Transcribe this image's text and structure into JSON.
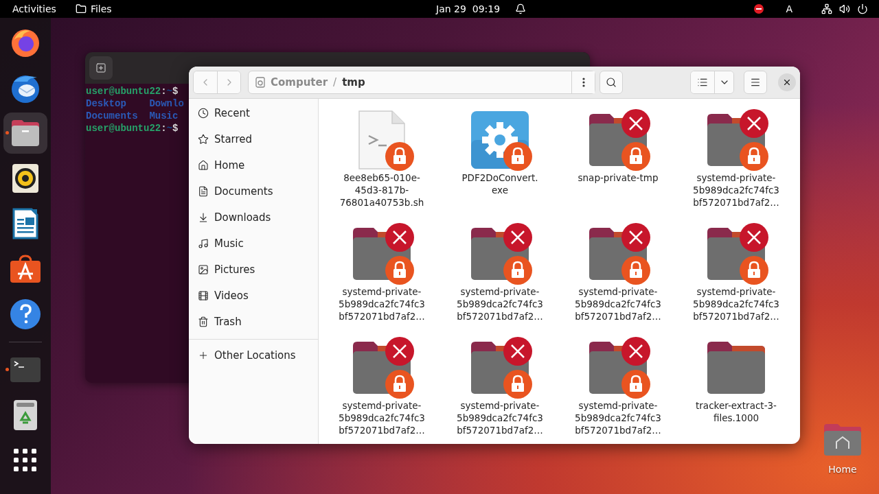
{
  "top_bar": {
    "activities": "Activities",
    "app_menu": "Files",
    "clock": "Jan 29  09:19",
    "keyboard": "A"
  },
  "dock": {
    "apps": [
      {
        "running": false,
        "active": false
      },
      {
        "running": false,
        "active": false
      },
      {
        "running": true,
        "active": true
      },
      {
        "running": false,
        "active": false
      },
      {
        "running": false,
        "active": false
      },
      {
        "running": false,
        "active": false
      },
      {
        "running": false,
        "active": false
      },
      {
        "running": true,
        "active": false
      },
      {
        "running": false,
        "active": false
      },
      {
        "running": false,
        "active": false
      }
    ]
  },
  "terminal": {
    "lines": [
      {
        "kind": "prompt",
        "user": "user@ubuntu22",
        "colon": ":",
        "path": "~",
        "sign": "$"
      },
      {
        "kind": "listing",
        "items": [
          "Desktop",
          "Downlo"
        ]
      },
      {
        "kind": "listing",
        "items": [
          "Documents",
          "Music"
        ]
      },
      {
        "kind": "prompt",
        "user": "user@ubuntu22",
        "colon": ":",
        "path": "~",
        "sign": "$"
      }
    ]
  },
  "files": {
    "path": [
      "Computer",
      "tmp"
    ],
    "path_separator": "/",
    "sidebar": {
      "items": [
        {
          "label": "Recent"
        },
        {
          "label": "Starred"
        },
        {
          "label": "Home"
        },
        {
          "label": "Documents"
        },
        {
          "label": "Downloads"
        },
        {
          "label": "Music"
        },
        {
          "label": "Pictures"
        },
        {
          "label": "Videos"
        },
        {
          "label": "Trash"
        }
      ],
      "other": "Other Locations"
    },
    "items": [
      {
        "kind": "script",
        "name_lines": [
          "8ee8eb65-010e-",
          "45d3-817b-",
          "76801a40753b.sh"
        ],
        "locked": true,
        "unreadable": false
      },
      {
        "kind": "exe",
        "name_lines": [
          "PDF2DoConvert.",
          "exe"
        ],
        "locked": true,
        "unreadable": false
      },
      {
        "kind": "folder",
        "name_lines": [
          "snap-private-tmp"
        ],
        "locked": true,
        "unreadable": true
      },
      {
        "kind": "folder",
        "name_lines": [
          "systemd-private-",
          "5b989dca2fc74fc3",
          "bf572071bd7af2…"
        ],
        "locked": true,
        "unreadable": true
      },
      {
        "kind": "folder",
        "name_lines": [
          "systemd-private-",
          "5b989dca2fc74fc3",
          "bf572071bd7af2…"
        ],
        "locked": true,
        "unreadable": true
      },
      {
        "kind": "folder",
        "name_lines": [
          "systemd-private-",
          "5b989dca2fc74fc3",
          "bf572071bd7af2…"
        ],
        "locked": true,
        "unreadable": true
      },
      {
        "kind": "folder",
        "name_lines": [
          "systemd-private-",
          "5b989dca2fc74fc3",
          "bf572071bd7af2…"
        ],
        "locked": true,
        "unreadable": true
      },
      {
        "kind": "folder",
        "name_lines": [
          "systemd-private-",
          "5b989dca2fc74fc3",
          "bf572071bd7af2…"
        ],
        "locked": true,
        "unreadable": true
      },
      {
        "kind": "folder",
        "name_lines": [
          "systemd-private-",
          "5b989dca2fc74fc3",
          "bf572071bd7af2…"
        ],
        "locked": true,
        "unreadable": true
      },
      {
        "kind": "folder",
        "name_lines": [
          "systemd-private-",
          "5b989dca2fc74fc3",
          "bf572071bd7af2…"
        ],
        "locked": true,
        "unreadable": true
      },
      {
        "kind": "folder",
        "name_lines": [
          "systemd-private-",
          "5b989dca2fc74fc3",
          "bf572071bd7af2…"
        ],
        "locked": true,
        "unreadable": true
      },
      {
        "kind": "folder",
        "name_lines": [
          "tracker-extract-3-",
          "files.1000"
        ],
        "locked": false,
        "unreadable": false
      }
    ]
  },
  "desktop_icons": [
    {
      "label": "Home"
    }
  ]
}
